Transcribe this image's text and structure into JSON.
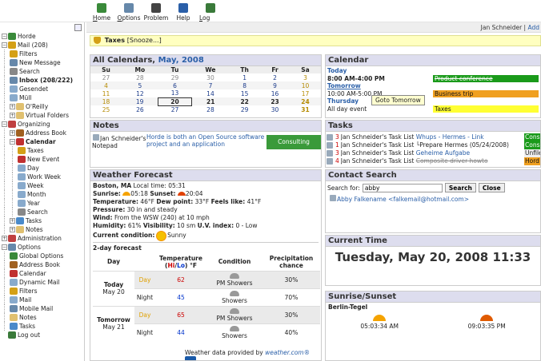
{
  "topmenu": {
    "items": [
      {
        "label": "Home",
        "ul": "H",
        "rest": "ome",
        "color": "#3a8a3a"
      },
      {
        "label": "Options",
        "ul": "O",
        "rest": "ptions",
        "color": "#6688aa"
      },
      {
        "label": "Problem",
        "ul": "",
        "rest": "Problem",
        "color": "#444444"
      },
      {
        "label": "Help",
        "ul": "",
        "rest": "Help",
        "color": "#2a5fa8"
      },
      {
        "label": "Log out",
        "ul": "L",
        "rest": "og out",
        "color": "#3a7a3a"
      }
    ]
  },
  "user": {
    "name": "Jan Schneider",
    "sep": "|",
    "add": "Add"
  },
  "sidebar": {
    "items": [
      {
        "label": "Horde",
        "depth": 0,
        "box": "−",
        "icon": "#3a8a3a",
        "bold": false
      },
      {
        "label": "Mail (208)",
        "depth": 0,
        "box": "−",
        "icon": "#d4a017",
        "bold": false
      },
      {
        "label": "Filters",
        "depth": 1,
        "box": "",
        "icon": "#d4a017",
        "bold": false
      },
      {
        "label": "New Message",
        "depth": 1,
        "box": "",
        "icon": "#6688aa",
        "bold": false
      },
      {
        "label": "Search",
        "depth": 1,
        "box": "",
        "icon": "#888888",
        "bold": false
      },
      {
        "label": "Inbox (208/222)",
        "depth": 1,
        "box": "",
        "icon": "#6688aa",
        "bold": true
      },
      {
        "label": "Gesendet",
        "depth": 1,
        "box": "",
        "icon": "#88aacc",
        "bold": false
      },
      {
        "label": "Müll",
        "depth": 1,
        "box": "",
        "icon": "#88aacc",
        "bold": false
      },
      {
        "label": "O'Reilly",
        "depth": 1,
        "box": "+",
        "icon": "#e0c070",
        "bold": false
      },
      {
        "label": "Virtual Folders",
        "depth": 1,
        "box": "+",
        "icon": "#e0c070",
        "bold": false
      },
      {
        "label": "Organizing",
        "depth": 0,
        "box": "−",
        "icon": "#c04040",
        "bold": false
      },
      {
        "label": "Address Book",
        "depth": 1,
        "box": "+",
        "icon": "#a06020",
        "bold": false
      },
      {
        "label": "Calendar",
        "depth": 1,
        "box": "−",
        "icon": "#c03030",
        "bold": true
      },
      {
        "label": "Taxes",
        "depth": 2,
        "box": "",
        "icon": "#d4a017",
        "bold": false
      },
      {
        "label": "New Event",
        "depth": 2,
        "box": "",
        "icon": "#c03030",
        "bold": false
      },
      {
        "label": "Day",
        "depth": 2,
        "box": "",
        "icon": "#88aacc",
        "bold": false
      },
      {
        "label": "Work Week",
        "depth": 2,
        "box": "",
        "icon": "#88aacc",
        "bold": false
      },
      {
        "label": "Week",
        "depth": 2,
        "box": "",
        "icon": "#88aacc",
        "bold": false
      },
      {
        "label": "Month",
        "depth": 2,
        "box": "",
        "icon": "#88aacc",
        "bold": false
      },
      {
        "label": "Year",
        "depth": 2,
        "box": "",
        "icon": "#88aacc",
        "bold": false
      },
      {
        "label": "Search",
        "depth": 2,
        "box": "",
        "icon": "#888888",
        "bold": false
      },
      {
        "label": "Tasks",
        "depth": 1,
        "box": "+",
        "icon": "#4a8aca",
        "bold": false
      },
      {
        "label": "Notes",
        "depth": 1,
        "box": "+",
        "icon": "#e0c070",
        "bold": false
      },
      {
        "label": "Administration",
        "depth": 0,
        "box": "+",
        "icon": "#c04040",
        "bold": false
      },
      {
        "label": "Options",
        "depth": 0,
        "box": "−",
        "icon": "#6688aa",
        "bold": false
      },
      {
        "label": "Global Options",
        "depth": 1,
        "box": "",
        "icon": "#3a8a3a",
        "bold": false
      },
      {
        "label": "Address Book",
        "depth": 1,
        "box": "",
        "icon": "#a06020",
        "bold": false
      },
      {
        "label": "Calendar",
        "depth": 1,
        "box": "",
        "icon": "#c03030",
        "bold": false
      },
      {
        "label": "Dynamic Mail",
        "depth": 1,
        "box": "",
        "icon": "#88aacc",
        "bold": false
      },
      {
        "label": "Filters",
        "depth": 1,
        "box": "",
        "icon": "#d4a017",
        "bold": false
      },
      {
        "label": "Mail",
        "depth": 1,
        "box": "",
        "icon": "#88aacc",
        "bold": false
      },
      {
        "label": "Mobile Mail",
        "depth": 1,
        "box": "",
        "icon": "#6688aa",
        "bold": false
      },
      {
        "label": "Notes",
        "depth": 1,
        "box": "",
        "icon": "#e0c070",
        "bold": false
      },
      {
        "label": "Tasks",
        "depth": 1,
        "box": "",
        "icon": "#4a8aca",
        "bold": false
      },
      {
        "label": "Log out",
        "depth": 0,
        "box": "",
        "icon": "#3a7a3a",
        "bold": false
      }
    ]
  },
  "alarm": {
    "title": "Taxes",
    "snooze": "[Snooze...]"
  },
  "calendar": {
    "title_prefix": "All Calendars, ",
    "title_month": "May, 2008",
    "weekdays": [
      "Su",
      "Mo",
      "Tu",
      "We",
      "Th",
      "Fr",
      "Sa"
    ],
    "weeks": [
      [
        {
          "d": "27",
          "c": "other"
        },
        {
          "d": "28",
          "c": "other"
        },
        {
          "d": "29",
          "c": "other"
        },
        {
          "d": "30",
          "c": "other"
        },
        {
          "d": "1",
          "c": "cur"
        },
        {
          "d": "2",
          "c": "cur"
        },
        {
          "d": "3",
          "c": "we"
        }
      ],
      [
        {
          "d": "4",
          "c": "we"
        },
        {
          "d": "5",
          "c": "cur"
        },
        {
          "d": "6",
          "c": "cur"
        },
        {
          "d": "7",
          "c": "cur"
        },
        {
          "d": "8",
          "c": "cur"
        },
        {
          "d": "9",
          "c": "cur"
        },
        {
          "d": "10",
          "c": "we"
        }
      ],
      [
        {
          "d": "11",
          "c": "we"
        },
        {
          "d": "12",
          "c": "cur"
        },
        {
          "d": "13",
          "c": "cur"
        },
        {
          "d": "14",
          "c": "cur"
        },
        {
          "d": "15",
          "c": "cur"
        },
        {
          "d": "16",
          "c": "cur"
        },
        {
          "d": "17",
          "c": "we"
        }
      ],
      [
        {
          "d": "18",
          "c": "we"
        },
        {
          "d": "19",
          "c": "cur"
        },
        {
          "d": "20",
          "c": "today"
        },
        {
          "d": "21",
          "c": "bold"
        },
        {
          "d": "22",
          "c": "bold"
        },
        {
          "d": "23",
          "c": "bold"
        },
        {
          "d": "24",
          "c": "we bold"
        }
      ],
      [
        {
          "d": "25",
          "c": "we"
        },
        {
          "d": "26",
          "c": "cur"
        },
        {
          "d": "27",
          "c": "cur"
        },
        {
          "d": "28",
          "c": "cur"
        },
        {
          "d": "29",
          "c": "cur"
        },
        {
          "d": "30",
          "c": "cur"
        },
        {
          "d": "31",
          "c": "we bold"
        }
      ]
    ]
  },
  "notes": {
    "title": "Notes",
    "rows": [
      {
        "owner": "Jan Schneider's Notepad",
        "text": "Horde is both an Open Source software project and an application",
        "category": "Consulting"
      }
    ]
  },
  "weather": {
    "title": "Weather Forecast",
    "location": "Boston, MA",
    "local_time_label": "Local time:",
    "local_time": "05:31",
    "sunrise_label": "Sunrise:",
    "sunrise": "05:18",
    "sunset_label": "Sunset:",
    "sunset": "20:04",
    "temp_label": "Temperature:",
    "temp": "46°F",
    "dew_label": "Dew point:",
    "dew": "33°F",
    "feels_label": "Feels like:",
    "feels": "41°F",
    "pressure_label": "Pressure:",
    "pressure": "30 in and steady",
    "wind_label": "Wind:",
    "wind": "From the WSW (240) at 10 mph",
    "humidity_label": "Humidity:",
    "humidity": "61%",
    "visibility_label": "Visibility:",
    "visibility": "10 sm",
    "uv_label": "U.V. index:",
    "uv": "0 - Low",
    "condition_label": "Current condition:",
    "condition": "Sunny",
    "forecast_title": "2-day forecast",
    "cols": {
      "day": "Day",
      "temp": "Temperature",
      "hilo_open": "(",
      "hi": "Hi",
      "slash": "/",
      "lo": "Lo",
      "hilo_close": ") °F",
      "cond": "Condition",
      "precip": "Precipitation chance"
    },
    "days": [
      {
        "name": "Today",
        "date": "May 20",
        "day_label": "Day",
        "hi": "62",
        "day_cond": "PM Showers",
        "day_precip": "30%",
        "night_label": "Night",
        "lo": "45",
        "night_cond": "Showers",
        "night_precip": "70%"
      },
      {
        "name": "Tomorrow",
        "date": "May 21",
        "day_label": "Day",
        "hi": "65",
        "day_cond": "PM Showers",
        "day_precip": "30%",
        "night_label": "Night",
        "lo": "44",
        "night_cond": "Showers",
        "night_precip": "40%"
      }
    ],
    "credit_text": "Weather data provided by",
    "credit_link": "weather.com®"
  },
  "rcal": {
    "title": "Calendar",
    "today_label": "Today",
    "today_event_time": "8:00 AM-4:00 PM",
    "today_event_title": "Product conference",
    "tomorrow_label": "Tomorrow",
    "tomorrow_event_time": "10:00 AM-5:00 PM",
    "tomorrow_event_title": "Business trip",
    "thursday_label": "Thursday",
    "thursday_event_time": "All day event",
    "thursday_event_title": "Taxes",
    "tooltip": "Goto Tomorrow"
  },
  "tasks": {
    "title": "Tasks",
    "items": [
      {
        "pri": "3",
        "owner": "Jan Schneider's Task List",
        "name": "Whups - Hermes - Link",
        "extra": "",
        "strike": false,
        "cat": "Cons",
        "cat_color": "#1a9a1a",
        "cat_text": "#ffffff"
      },
      {
        "pri": "1",
        "owner": "Jan Schneider's Task List",
        "name": "",
        "extra": "└Prepare Hermes (05/24/2008)",
        "strike": false,
        "cat": "Cons",
        "cat_color": "#1a9a1a",
        "cat_text": "#ffffff"
      },
      {
        "pri": "3",
        "owner": "Jan Schneider's Task List",
        "name": "Geheime Aufgabe",
        "extra": "",
        "strike": false,
        "cat": "Unfile",
        "cat_color": "#eeeeee",
        "cat_text": "#222222"
      },
      {
        "pri": "4",
        "owner": "Jan Schneider's Task List",
        "name": "Composite driver howto",
        "extra": "",
        "strike": true,
        "cat": "Hord",
        "cat_color": "#f0a020",
        "cat_text": "#111111"
      }
    ]
  },
  "contact": {
    "title": "Contact Search",
    "label": "Search for:",
    "value": "abby",
    "search_btn": "Search",
    "close_btn": "Close",
    "result": "Abby Falkename <falkemail@hotmail.com>"
  },
  "ctime": {
    "title": "Current Time",
    "value": "Tuesday, May 20, 2008 11:33"
  },
  "sun": {
    "title": "Sunrise/Sunset",
    "city": "Berlin-Tegel",
    "rise": "05:03:34 AM",
    "set": "09:03:35 PM"
  },
  "colors": {
    "accent": "#2a5fa8",
    "header_bg": "#dde",
    "alarm_bg": "#ffffc0"
  }
}
